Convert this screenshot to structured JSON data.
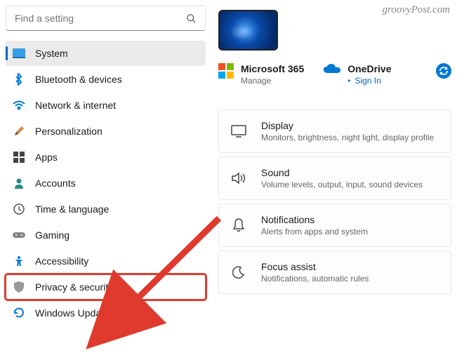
{
  "watermark": "groovyPost.com",
  "search": {
    "placeholder": "Find a setting"
  },
  "sidebar": {
    "items": [
      {
        "label": "System"
      },
      {
        "label": "Bluetooth & devices"
      },
      {
        "label": "Network & internet"
      },
      {
        "label": "Personalization"
      },
      {
        "label": "Apps"
      },
      {
        "label": "Accounts"
      },
      {
        "label": "Time & language"
      },
      {
        "label": "Gaming"
      },
      {
        "label": "Accessibility"
      },
      {
        "label": "Privacy & security"
      },
      {
        "label": "Windows Update"
      }
    ]
  },
  "cloud": {
    "ms365": {
      "title": "Microsoft 365",
      "sub": "Manage"
    },
    "onedrive": {
      "title": "OneDrive",
      "sub": "Sign In"
    }
  },
  "settings": [
    {
      "title": "Display",
      "sub": "Monitors, brightness, night light, display profile"
    },
    {
      "title": "Sound",
      "sub": "Volume levels, output, input, sound devices"
    },
    {
      "title": "Notifications",
      "sub": "Alerts from apps and system"
    },
    {
      "title": "Focus assist",
      "sub": "Notifications, automatic rules"
    }
  ]
}
